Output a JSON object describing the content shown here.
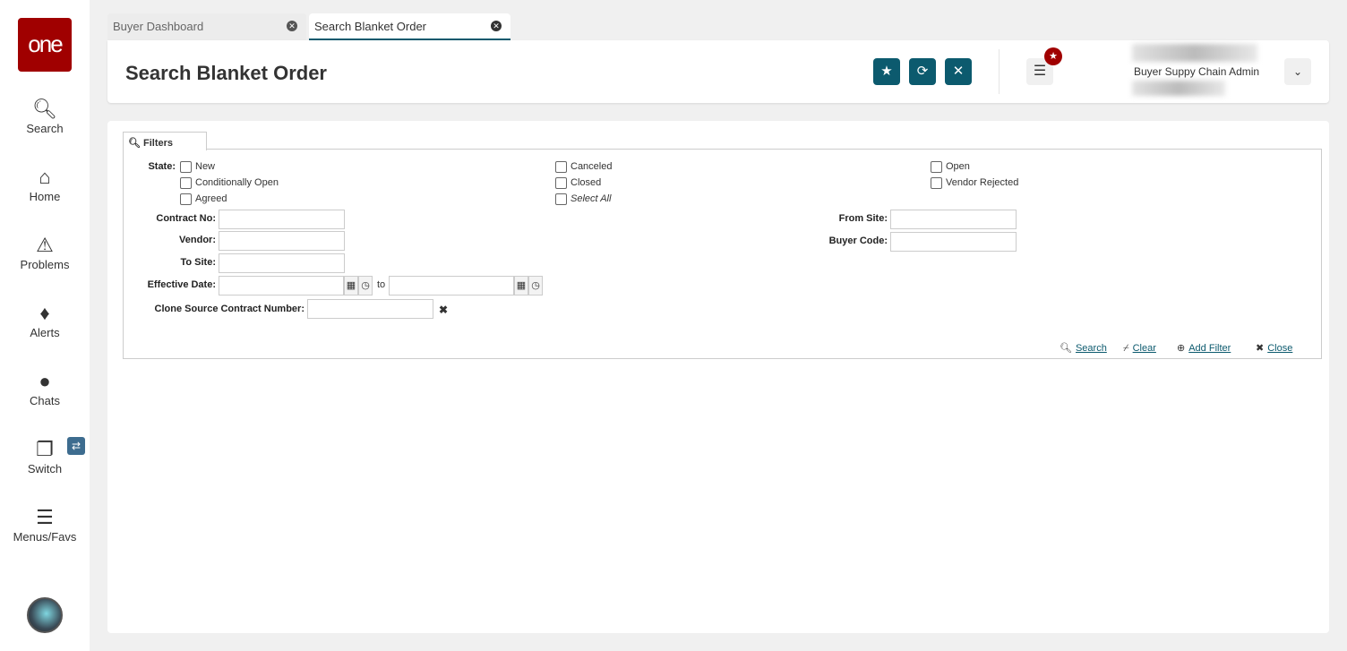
{
  "sidebar": {
    "logo": "one",
    "items": [
      {
        "label": "Search",
        "icon": "search-icon"
      },
      {
        "label": "Home",
        "icon": "home-icon"
      },
      {
        "label": "Problems",
        "icon": "warning-icon"
      },
      {
        "label": "Alerts",
        "icon": "bell-icon"
      },
      {
        "label": "Chats",
        "icon": "chat-icon"
      },
      {
        "label": "Switch",
        "icon": "switch-icon"
      },
      {
        "label": "Menus/Favs",
        "icon": "menu-icon"
      }
    ]
  },
  "tabs": [
    {
      "label": "Buyer Dashboard",
      "active": false
    },
    {
      "label": "Search Blanket Order",
      "active": true
    }
  ],
  "header": {
    "title": "Search Blanket Order",
    "user_role": "Buyer Suppy Chain Admin"
  },
  "filters": {
    "tab_label": "Filters",
    "state_label": "State:",
    "states": [
      {
        "label": "New"
      },
      {
        "label": "Conditionally Open"
      },
      {
        "label": "Agreed"
      },
      {
        "label": "Canceled"
      },
      {
        "label": "Closed"
      },
      {
        "label": "Select All"
      },
      {
        "label": "Open"
      },
      {
        "label": "Vendor Rejected"
      }
    ],
    "contract_no": "Contract No:",
    "vendor": "Vendor:",
    "to_site": "To Site:",
    "effective_date": "Effective Date:",
    "to": "to",
    "clone_source": "Clone Source Contract Number:",
    "from_site": "From Site:",
    "buyer_code": "Buyer Code:",
    "actions": {
      "search": "Search",
      "clear": "Clear",
      "add_filter": "Add Filter",
      "close": "Close"
    }
  },
  "colors": {
    "brand": "#a00000",
    "accent": "#0c5a6e"
  }
}
